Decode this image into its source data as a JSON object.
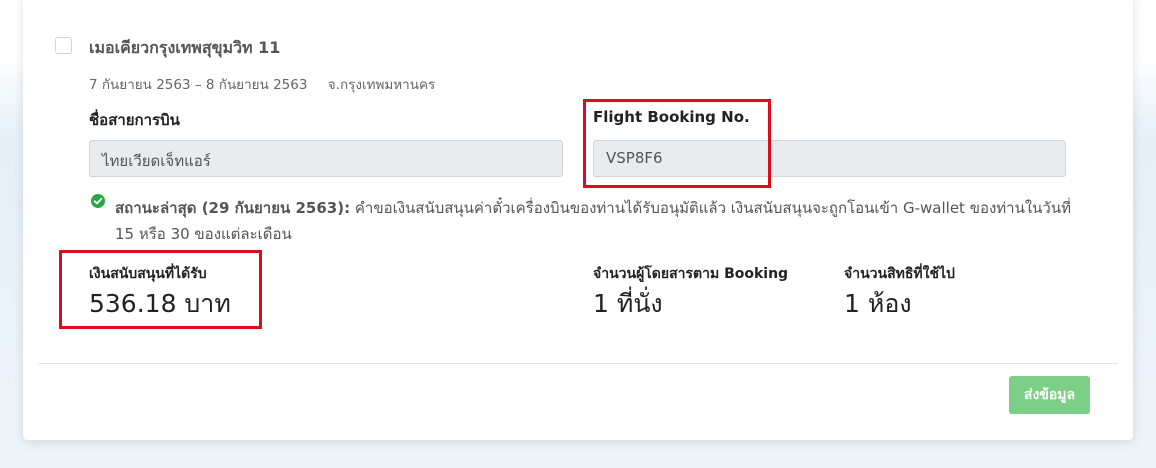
{
  "hotel": {
    "name": "เมอเคียวกรุงเทพสุขุมวิท 11",
    "dates": "7 กันยายน 2563 – 8 กันยายน 2563",
    "location": "จ.กรุงเทพมหานคร"
  },
  "airline": {
    "label": "ชื่อสายการบิน",
    "value": "ไทยเวียดเจ็ทแอร์"
  },
  "flight_booking": {
    "label": "Flight Booking No.",
    "value": "VSP8F6"
  },
  "status": {
    "label": "สถานะล่าสุด (29 กันยายน 2563):",
    "text": "คำขอเงินสนับสนุนค่าตั๋วเครื่องบินของท่านได้รับอนุมัติแล้ว เงินสนับสนุนจะถูกโอนเข้า G-wallet ของท่านในวันที่ 15 หรือ 30 ของแต่ละเดือน",
    "icon": "check-circle-icon",
    "color": "#28a745"
  },
  "subsidy": {
    "label": "เงินสนับสนุนที่ได้รับ",
    "value": "536.18 บาท"
  },
  "passengers": {
    "label": "จำนวนผู้โดยสารตาม Booking",
    "value": "1 ที่นั่ง"
  },
  "rights_used": {
    "label": "จำนวนสิทธิที่ใช้ไป",
    "value": "1 ห้อง"
  },
  "submit_button": {
    "label": "ส่งข้อมูล",
    "color": "#7ccf86"
  },
  "highlight_color": "#dd0b1c"
}
